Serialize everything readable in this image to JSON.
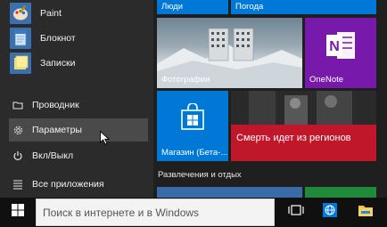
{
  "start_menu": {
    "recent_apps": [
      {
        "label": "Paint",
        "icon": "paint-icon"
      },
      {
        "label": "Блокнот",
        "icon": "notepad-icon"
      },
      {
        "label": "Записки",
        "icon": "sticky-notes-icon"
      }
    ],
    "system_items": [
      {
        "label": "Проводник",
        "icon": "file-explorer-icon"
      },
      {
        "label": "Параметры",
        "icon": "gear-icon"
      },
      {
        "label": "Вкл/Выкл",
        "icon": "power-icon"
      },
      {
        "label": "Все приложения",
        "icon": "all-apps-icon"
      }
    ]
  },
  "tiles": {
    "people": {
      "label": "Люди",
      "color": "#0078d7"
    },
    "weather": {
      "label": "Погода",
      "color": "#0078d7"
    },
    "photos": {
      "label": "Фотографии"
    },
    "onenote": {
      "label": "OneNote",
      "color": "#7719aa"
    },
    "store": {
      "label": "Магазин (Бета-...",
      "color": "#0078d7"
    },
    "news": {
      "label": "Смерть идет из регионов",
      "color": "#c0172b"
    }
  },
  "section_heading": "Развлечения и отдых",
  "taskbar": {
    "search_placeholder": "Поиск в интернете и в Windows",
    "icons": [
      "windows-logo-icon",
      "task-view-icon",
      "internet-explorer-icon",
      "file-explorer-folder-icon"
    ]
  },
  "colors": {
    "accent": "#0078d7",
    "menu_bg": "#2b2b2b",
    "taskbar_bg": "#101010"
  }
}
